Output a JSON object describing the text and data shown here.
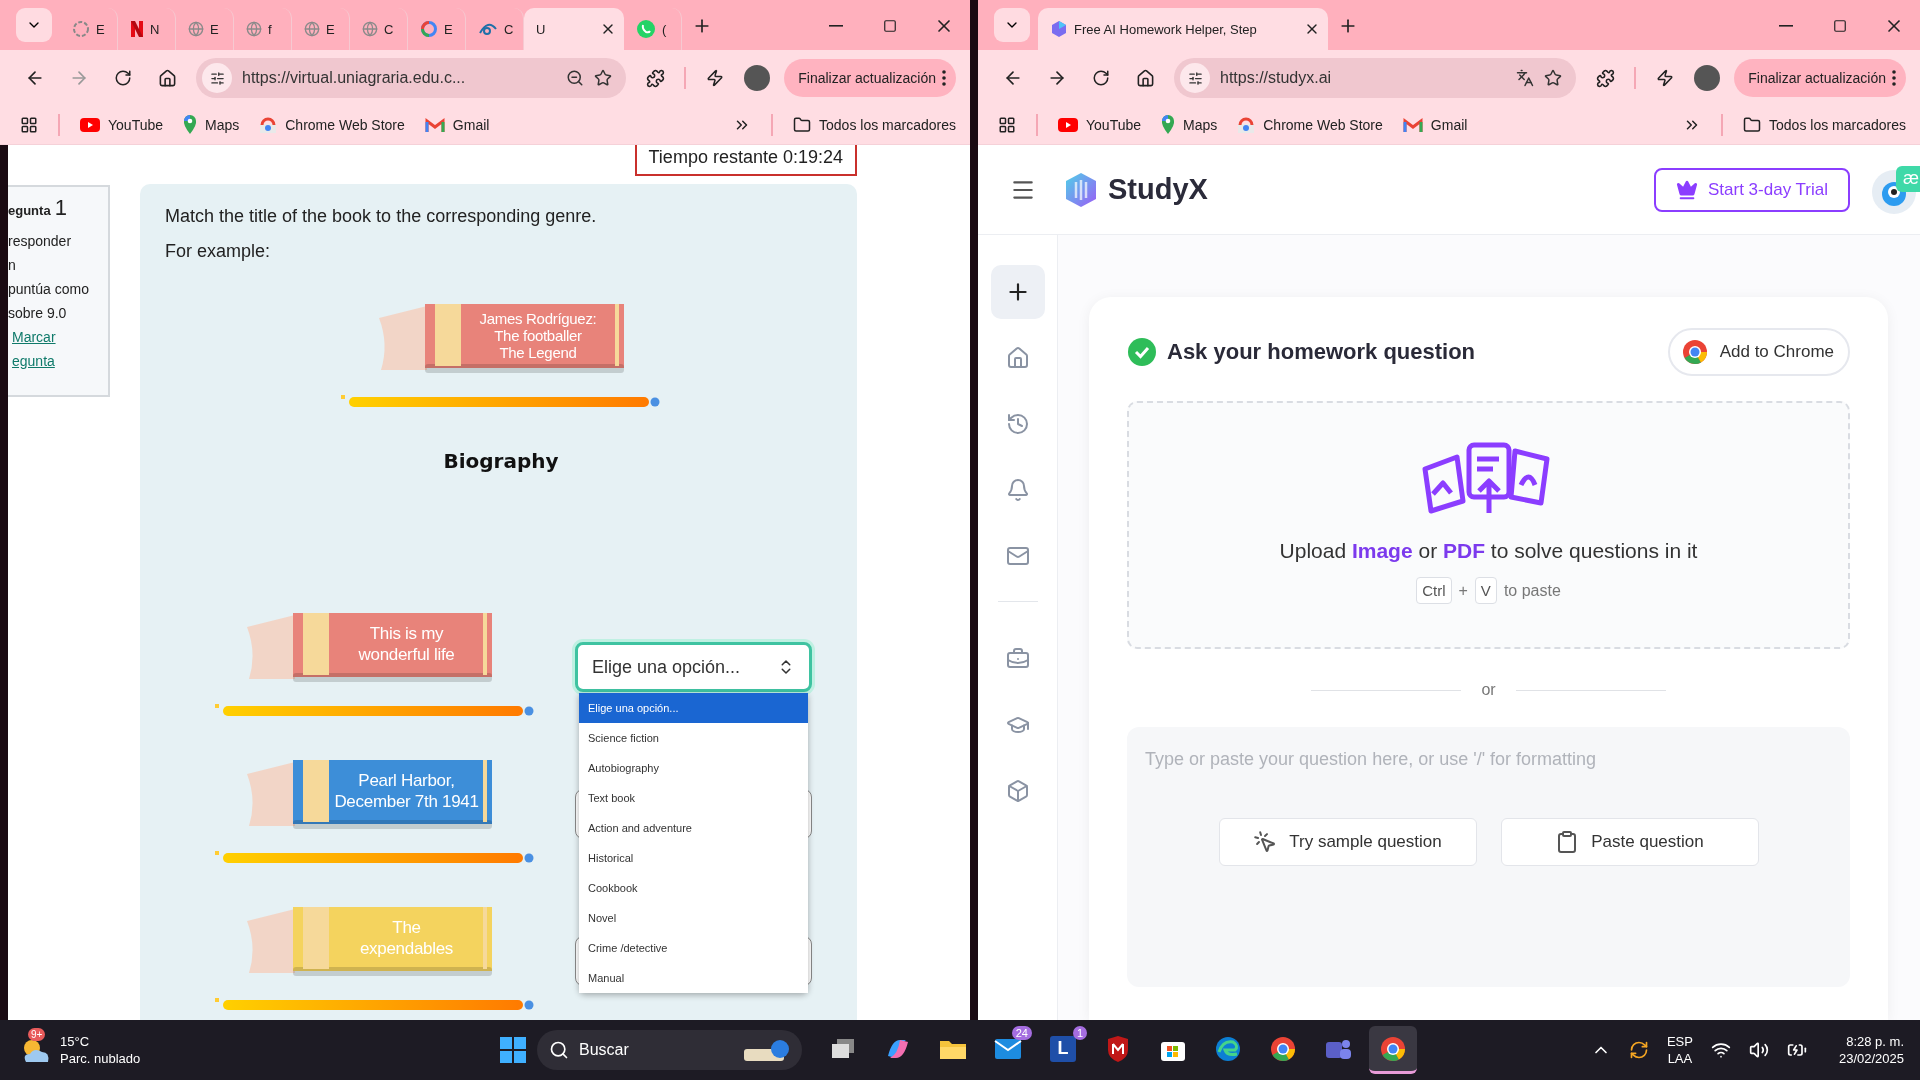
{
  "left_window": {
    "tabs": [
      {
        "kind": "loading",
        "label": "E",
        "selected": false
      },
      {
        "kind": "netflix",
        "label": "N",
        "selected": false
      },
      {
        "kind": "globe",
        "label": "E",
        "selected": false
      },
      {
        "kind": "globe",
        "label": "f",
        "selected": false
      },
      {
        "kind": "globe",
        "label": "E",
        "selected": false
      },
      {
        "kind": "globe",
        "label": "C",
        "selected": false
      },
      {
        "kind": "google",
        "label": "E",
        "selected": false
      },
      {
        "kind": "disney",
        "label": "C",
        "selected": false
      },
      {
        "kind": "blank",
        "label": "U",
        "selected": true
      },
      {
        "kind": "whatsapp",
        "label": "(",
        "selected": false
      }
    ],
    "address_bar": {
      "url": "https://virtual.uniagraria.edu.c...",
      "kind": "zoom"
    },
    "update_button": "Finalizar actualización",
    "bookmarks": [
      {
        "kind": "youtube",
        "label": "YouTube"
      },
      {
        "kind": "maps",
        "label": "Maps"
      },
      {
        "kind": "webstore",
        "label": "Chrome Web Store"
      },
      {
        "kind": "gmail",
        "label": "Gmail"
      }
    ],
    "all_bookmarks": "Todos los marcadores"
  },
  "quiz": {
    "nav": {
      "heading": "egunta",
      "number": "1",
      "lines": [
        "responder",
        "n",
        "puntúa como",
        "sobre 9.0"
      ],
      "flag_links": [
        "Marcar",
        "egunta"
      ]
    },
    "timer": "Tiempo restante 0:19:24",
    "prompt": "Match the title of the book to the corresponding genre.",
    "example_label": "For example:",
    "example_book": {
      "lines": [
        "James Rodríguez:",
        "The footballer",
        "The Legend"
      ],
      "color": "#e8837a"
    },
    "example_genre": "Biography",
    "books": [
      {
        "lines": [
          "This is my",
          "wonderful life"
        ],
        "color": "#e8837a"
      },
      {
        "lines": [
          "Pearl Harbor,",
          "December 7th 1941"
        ],
        "color": "#3d8ed8"
      },
      {
        "lines": [
          "The",
          "expendables"
        ],
        "color": "#f4d35e"
      }
    ],
    "answer_select": {
      "value": "Elige una opción...",
      "expanded": true
    },
    "options": [
      {
        "label": "Elige una opción...",
        "selected": true
      },
      {
        "label": "Science fiction",
        "selected": false
      },
      {
        "label": "Autobiography",
        "selected": false
      },
      {
        "label": "Text book",
        "selected": false
      },
      {
        "label": "Action and adventure",
        "selected": false
      },
      {
        "label": "Historical",
        "selected": false
      },
      {
        "label": "Cookbook",
        "selected": false
      },
      {
        "label": "Novel",
        "selected": false
      },
      {
        "label": "Crime /detective",
        "selected": false
      },
      {
        "label": "Manual",
        "selected": false
      }
    ]
  },
  "right_window": {
    "tabs": [
      {
        "kind": "studyx",
        "label": "Free AI Homework Helper, Step",
        "selected": true
      }
    ],
    "address_bar": {
      "url": "https://studyx.ai",
      "kind": "translate"
    },
    "update_button": "Finalizar actualización",
    "bookmarks": [
      {
        "kind": "youtube",
        "label": "YouTube"
      },
      {
        "kind": "maps",
        "label": "Maps"
      },
      {
        "kind": "webstore",
        "label": "Chrome Web Store"
      },
      {
        "kind": "gmail",
        "label": "Gmail"
      }
    ],
    "all_bookmarks": "Todos los marcadores"
  },
  "studyx": {
    "brand": "StudyX",
    "trial_button": "Start 3-day Trial",
    "extension_badge": "æ",
    "sidebar": {
      "top": [
        {
          "kind": "new"
        },
        {
          "kind": "home"
        },
        {
          "kind": "history"
        },
        {
          "kind": "notifications"
        },
        {
          "kind": "messages"
        }
      ],
      "bottom": [
        {
          "kind": "tools"
        },
        {
          "kind": "courses"
        },
        {
          "kind": "package"
        }
      ]
    },
    "card": {
      "title": "Ask your homework question",
      "add_to_chrome": "Add to Chrome",
      "upload_text": "Upload **Image** or **PDF** to solve questions in it",
      "paste_keys": [
        "Ctrl",
        "V"
      ],
      "paste_plus": "+",
      "paste_hint": "to paste",
      "divider_label": "or",
      "question_placeholder": "Type or paste your question here, or use '/' for formatting",
      "buttons": [
        {
          "kind": "sample",
          "label": "Try sample question"
        },
        {
          "kind": "paste",
          "label": "Paste question"
        }
      ]
    }
  },
  "taskbar": {
    "weather": {
      "temperature": "15°C",
      "condition": "Parc. nublado",
      "badge": "9+"
    },
    "search_label": "Buscar",
    "apps": [
      {
        "kind": "taskview",
        "selected": false
      },
      {
        "kind": "copilot",
        "selected": false
      },
      {
        "kind": "explorer",
        "selected": false
      },
      {
        "kind": "mail",
        "badge": "24",
        "selected": false
      },
      {
        "kind": "letter",
        "label": "L",
        "badge": "1",
        "selected": false
      },
      {
        "kind": "shield",
        "selected": false
      },
      {
        "kind": "store",
        "selected": false
      },
      {
        "kind": "edge",
        "selected": false
      },
      {
        "kind": "chrome",
        "selected": false
      },
      {
        "kind": "teams",
        "selected": false
      },
      {
        "kind": "chrome",
        "selected": true
      }
    ],
    "tray": {
      "language": "ESP",
      "layout": "LAA",
      "time": "8:28 p. m.",
      "date": "23/02/2025"
    }
  }
}
